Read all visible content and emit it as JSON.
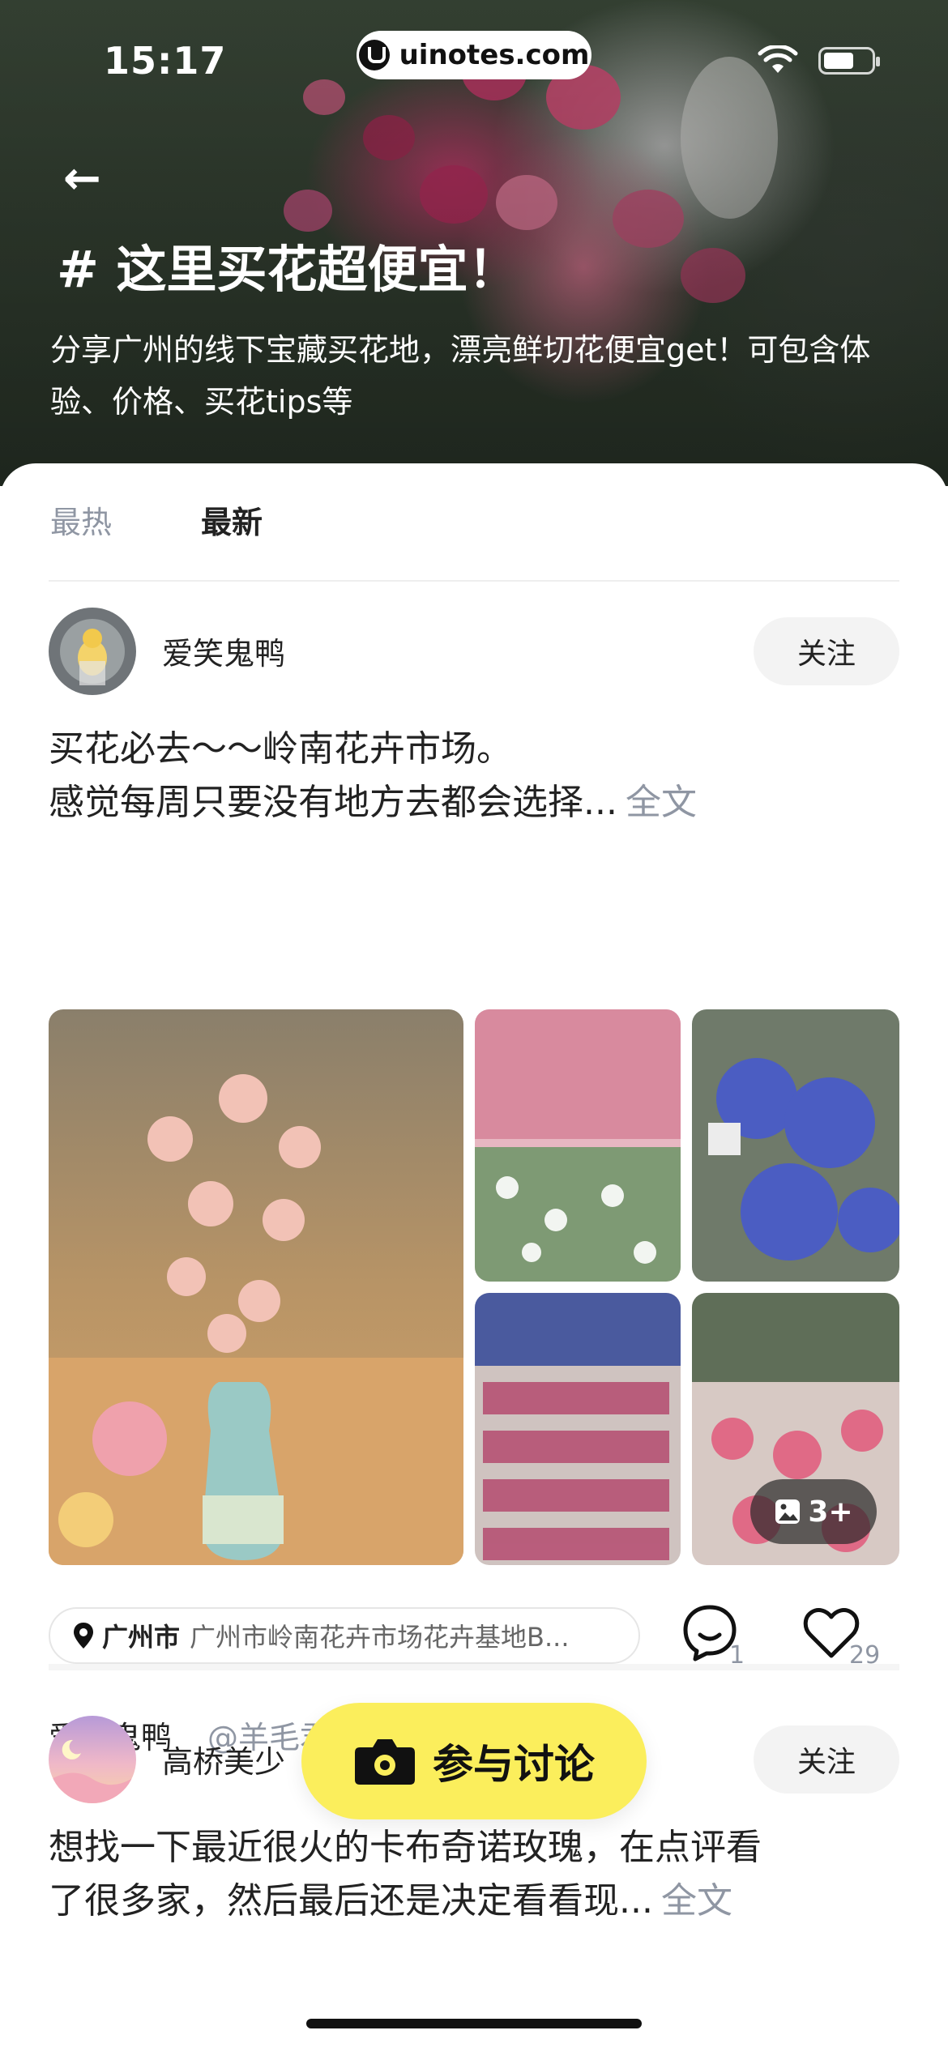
{
  "status": {
    "time": "15:17",
    "site": "uinotes.com"
  },
  "header": {
    "title": "# 这里买花超便宜！",
    "description": "分享广州的线下宝藏买花地，漂亮鲜切花便宜get！可包含体验、价格、买花tips等"
  },
  "tabs": [
    {
      "label": "最热"
    },
    {
      "label": "最新"
    }
  ],
  "posts": [
    {
      "username": "爱笑鬼鸭",
      "follow_label": "关注",
      "text_line1": "买花必去～～岭南花卉市场。",
      "text_line2": "感觉每周只要没有地方去都会选择...",
      "more_label": "全文",
      "photos_overlay": "3+",
      "location_city": "广州市",
      "location_addr": "广州市岭南花卉市场花卉基地B...",
      "comment_count": "1",
      "like_count": "29",
      "author": "爱笑鬼鸭",
      "mention": "@羊毛君"
    },
    {
      "username": "高桥美少",
      "follow_label": "关注",
      "text_line1": "想找一下最近很火的卡布奇诺玫瑰，在点评看",
      "text_line2": "了很多家，然后最后还是决定看看现...",
      "more_label": "全文"
    }
  ],
  "cta": {
    "label": "参与讨论"
  },
  "colors": {
    "accent_yellow": "#fbee5c",
    "muted_text": "#8f96a3"
  }
}
